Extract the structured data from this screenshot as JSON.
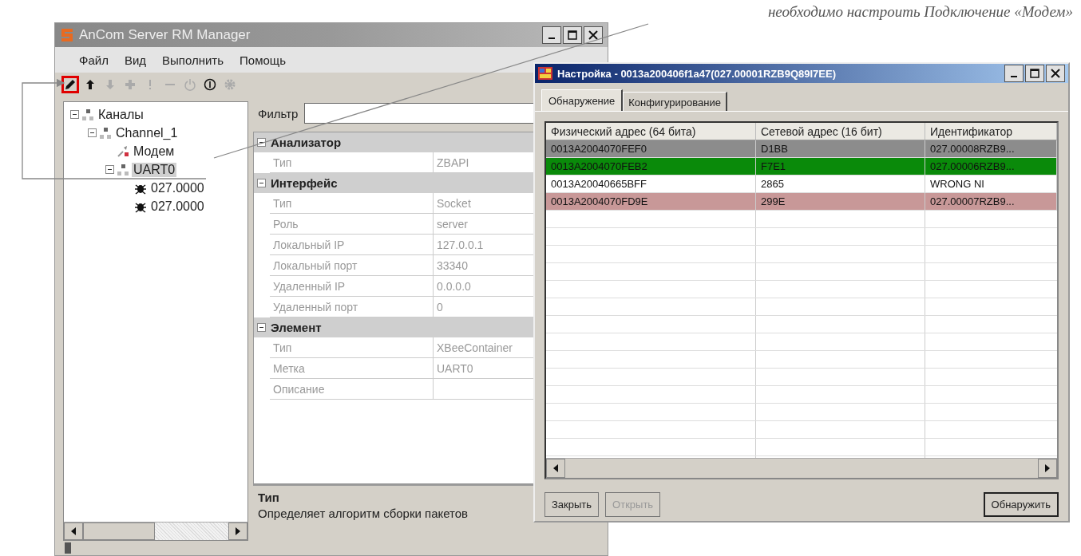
{
  "annotation": {
    "text": "необходимо настроить Подключение «Модем»"
  },
  "main_window": {
    "title": "AnCom Server RM Manager",
    "menu": [
      "Файл",
      "Вид",
      "Выполнить",
      "Помощь"
    ],
    "toolbar": [
      {
        "kind": "pencil",
        "disabled": false,
        "highlighted": true
      },
      {
        "kind": "up",
        "disabled": false,
        "highlighted": false
      },
      {
        "kind": "down",
        "disabled": true,
        "highlighted": false
      },
      {
        "kind": "plus",
        "disabled": true,
        "highlighted": false
      },
      {
        "kind": "exclamation",
        "disabled": true,
        "highlighted": false
      },
      {
        "kind": "minus",
        "disabled": true,
        "highlighted": false
      },
      {
        "kind": "power",
        "disabled": true,
        "highlighted": false
      },
      {
        "kind": "info",
        "disabled": false,
        "highlighted": false
      },
      {
        "kind": "gear",
        "disabled": true,
        "highlighted": false
      }
    ],
    "tree": [
      {
        "label": "Каналы",
        "kind": "network",
        "expanded": true,
        "selected": false,
        "children": [
          {
            "label": "Channel_1",
            "kind": "network",
            "expanded": true,
            "selected": false,
            "children": [
              {
                "label": "Модем",
                "kind": "modem",
                "selected": false
              },
              {
                "label": "UART0",
                "kind": "network",
                "expanded": true,
                "selected": true,
                "children": [
                  {
                    "label": "027.0000",
                    "kind": "device",
                    "selected": false
                  },
                  {
                    "label": "027.0000",
                    "kind": "device",
                    "selected": false
                  }
                ]
              }
            ]
          }
        ]
      }
    ],
    "filter": {
      "label": "Фильтр"
    },
    "properties": [
      {
        "category": "Анализатор",
        "expanded": true,
        "rows": [
          {
            "label": "Тип",
            "value": "ZBAPI"
          }
        ]
      },
      {
        "category": "Интерфейс",
        "expanded": true,
        "rows": [
          {
            "label": "Тип",
            "value": "Socket"
          },
          {
            "label": "Роль",
            "value": "server"
          },
          {
            "label": "Локальный IP",
            "value": "127.0.0.1"
          },
          {
            "label": "Локальный порт",
            "value": "33340"
          },
          {
            "label": "Удаленный IP",
            "value": "0.0.0.0"
          },
          {
            "label": "Удаленный порт",
            "value": "0"
          }
        ]
      },
      {
        "category": "Элемент",
        "expanded": true,
        "rows": [
          {
            "label": "Тип",
            "value": "XBeeContainer"
          },
          {
            "label": "Метка",
            "value": "UART0"
          },
          {
            "label": "Описание"
          }
        ]
      }
    ],
    "description": {
      "title": "Тип",
      "text": "Определяет алгоритм сборки пакетов"
    }
  },
  "dialog": {
    "title": "Настройка - 0013a200406f1a47(027.00001RZB9Q89I7EE)",
    "tabs": [
      {
        "label": "Обнаружение",
        "selected": true
      },
      {
        "label": "Конфигурирование",
        "selected": false
      }
    ],
    "table": {
      "columns": [
        "Физический адрес (64 бита)",
        "Сетевой адрес (16 бит)",
        "Идентификатор"
      ],
      "rows": [
        {
          "cells": [
            "0013A2004070FEF0",
            "D1BB",
            "027.00008RZB9..."
          ],
          "color": "#8c8c8c"
        },
        {
          "cells": [
            "0013A2004070FEB2",
            "F7E1",
            "027.00006RZB9..."
          ],
          "color": "#0a8a0a"
        },
        {
          "cells": [
            "0013A20040665BFF",
            "2865",
            "WRONG NI"
          ],
          "color": "#ffffff"
        },
        {
          "cells": [
            "0013A2004070FD9E",
            "299E",
            "027.00007RZB9..."
          ],
          "color": "#c89898"
        }
      ]
    },
    "buttons": [
      {
        "label": "Закрыть",
        "disabled": false,
        "default": false
      },
      {
        "label": "Открыть",
        "disabled": true,
        "default": false
      },
      {
        "label": "Обнаружить",
        "disabled": false,
        "default": true
      }
    ]
  }
}
